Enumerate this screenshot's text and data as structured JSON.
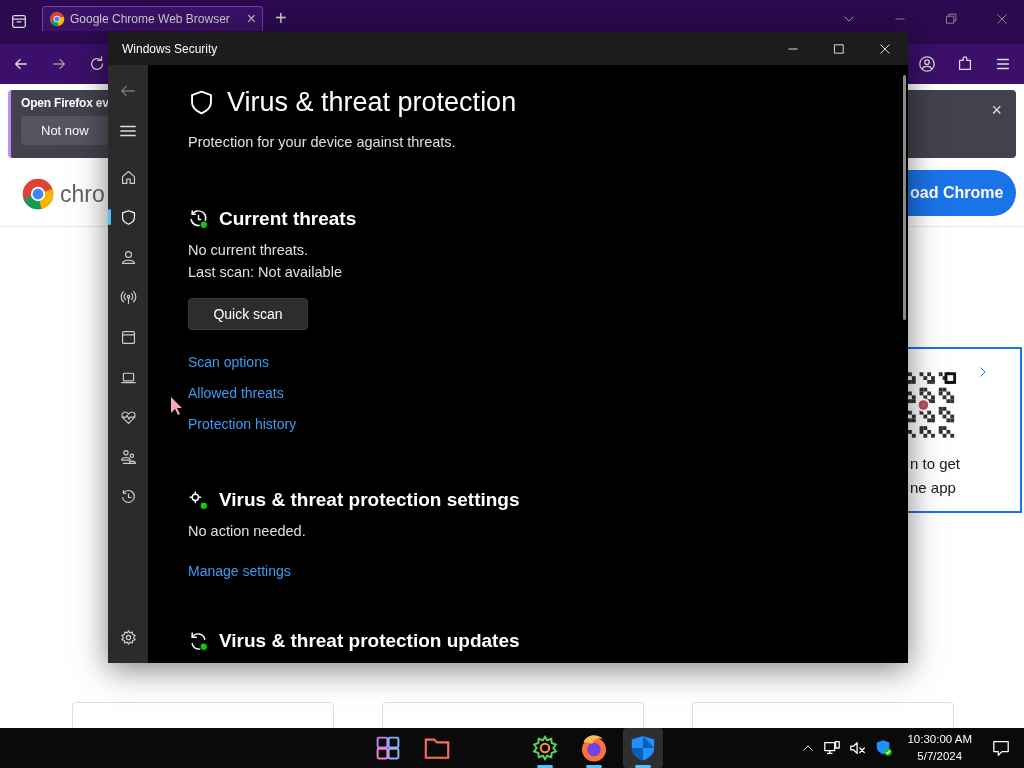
{
  "browser": {
    "tab": {
      "title": "Google Chrome Web Browser",
      "close": "×"
    },
    "new_tab": "+",
    "notification": {
      "text": "Open Firefox ev",
      "button": "Not now",
      "close": "×"
    },
    "page": {
      "logo_text": "chro",
      "download_button": "oad Chrome",
      "qr_card": {
        "lines": [
          "n to get",
          "ne app"
        ]
      }
    }
  },
  "security_window": {
    "title": "Windows Security",
    "nav_items": [
      {
        "kind": "home",
        "selected": false
      },
      {
        "kind": "shield",
        "selected": true
      },
      {
        "kind": "person",
        "selected": false
      },
      {
        "kind": "antenna",
        "selected": false
      },
      {
        "kind": "app",
        "selected": false
      },
      {
        "kind": "laptop",
        "selected": false
      },
      {
        "kind": "heart",
        "selected": false
      },
      {
        "kind": "family",
        "selected": false
      },
      {
        "kind": "history",
        "selected": false
      }
    ],
    "heading": "Virus & threat protection",
    "subtitle": "Protection for your device against threats.",
    "sections": [
      {
        "kind": "threats",
        "title": "Current threats",
        "lines": [
          "No current threats.",
          "Last scan: Not available"
        ],
        "button": "Quick scan",
        "links": [
          "Scan options",
          "Allowed threats",
          "Protection history"
        ]
      },
      {
        "kind": "settings",
        "title": "Virus & threat protection settings",
        "lines": [
          "No action needed."
        ],
        "links": [
          "Manage settings"
        ]
      },
      {
        "kind": "updates",
        "title": "Virus & threat protection updates"
      }
    ]
  },
  "taskbar": {
    "apps": [
      {
        "kind": "start",
        "running": false,
        "selected": false
      },
      {
        "kind": "folder",
        "running": false,
        "selected": false
      },
      {
        "kind": "settings",
        "running": true,
        "selected": false
      },
      {
        "kind": "firefox",
        "running": true,
        "selected": false
      },
      {
        "kind": "security",
        "running": true,
        "selected": true
      }
    ],
    "time": "10:30:00 AM",
    "date": "5/7/2024"
  }
}
